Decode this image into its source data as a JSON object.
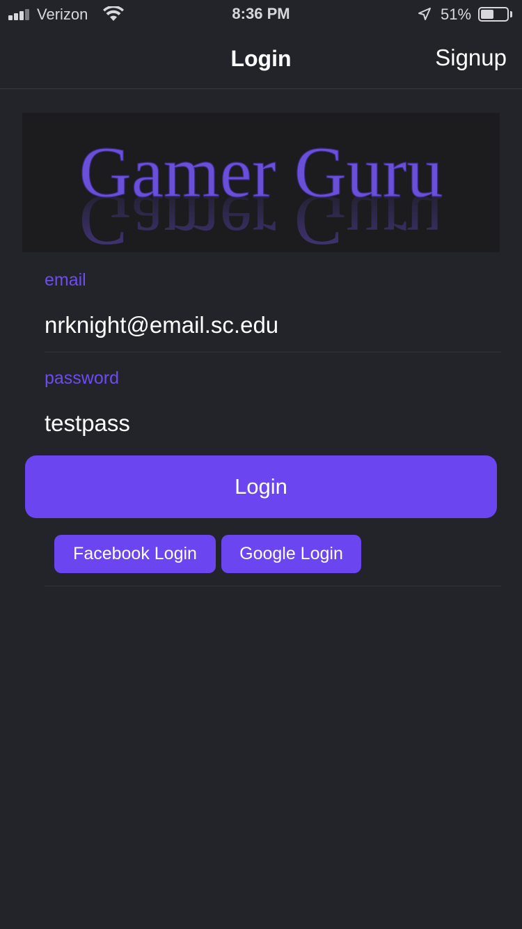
{
  "status_bar": {
    "carrier": "Verizon",
    "time": "8:36 PM",
    "battery_percent": "51%",
    "battery_level": 0.51,
    "icons": [
      "signal-icon",
      "wifi-icon",
      "location-arrow-icon",
      "battery-icon"
    ]
  },
  "nav": {
    "title": "Login",
    "signup_label": "Signup"
  },
  "logo": {
    "text": "Gamer Guru",
    "color": "#6a4fd8"
  },
  "form": {
    "email": {
      "label": "email",
      "value": "nrknight@email.sc.edu"
    },
    "password": {
      "label": "password",
      "value": "testpass"
    },
    "login_label": "Login",
    "facebook_label": "Facebook Login",
    "google_label": "Google Login"
  },
  "colors": {
    "background": "#232429",
    "accent": "#6a45f0",
    "label": "#6e4cf0"
  }
}
